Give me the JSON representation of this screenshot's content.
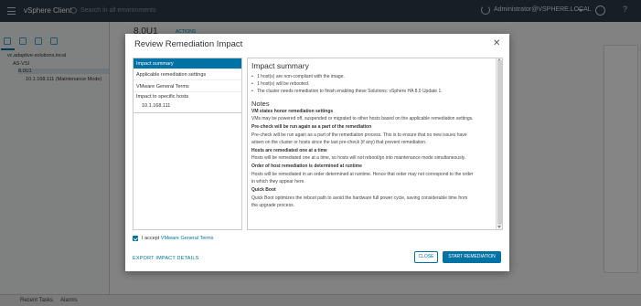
{
  "topbar": {
    "app_title": "vSphere Client",
    "search_placeholder": "Search in all environments",
    "user": "Administrator@VSPHERE.LOCAL",
    "help_icon": "?"
  },
  "leftnav": {
    "tree": [
      {
        "label": "vc.adaptive-solutions.local"
      },
      {
        "label": "AS-VSI"
      },
      {
        "label": "8.0U1"
      },
      {
        "label": "10.1.168.111 (Maintenance Mode)"
      }
    ]
  },
  "content": {
    "title": "8.0U1",
    "actions_label": "ACTIONS"
  },
  "bottombar": {
    "recent_tasks": "Recent Tasks",
    "alarms": "Alarms"
  },
  "modal": {
    "title": "Review Remediation Impact",
    "nav": {
      "items": [
        "Impact summary",
        "Applicable remediation settings",
        "VMware General Terms"
      ],
      "group_label": "Impact to specific hosts",
      "hosts": [
        "10.1.168.111"
      ]
    },
    "summary": {
      "heading": "Impact summary",
      "bullets": [
        "1 host(s) are non-compliant with the image.",
        "1 host(s) will be rebooted.",
        "The cluster needs remediation to finish enabling these Solutions: vSphere HA 8.0 Update 1."
      ],
      "notes_heading": "Notes",
      "notes": [
        {
          "title": "VM states honor remediation settings",
          "lines": [
            "VMs may be powered off, suspended or migrated to other hosts based on the applicable remediation settings."
          ]
        },
        {
          "title": "Pre-check will be run again as a part of the remediation",
          "lines": [
            "Pre-check will be run again as a part of the remediation process. This is to ensure that no new issues have",
            "arisen on the cluster or hosts since the last pre-check (if any) that prevent remediation."
          ]
        },
        {
          "title": "Hosts are remediated one at a time",
          "lines": [
            "Hosts will be remediated one at a time, so hosts will not reboot/go into maintenance mode simultaneously."
          ]
        },
        {
          "title": "Order of host remediation is determined at runtime",
          "lines": [
            "Hosts will be remediated in an order determined at runtime. Hence that order may not correspond to the order",
            "in which they appear here."
          ]
        },
        {
          "title": "Quick Boot",
          "lines": [
            "Quick Boot optimizes the reboot path to avoid the hardware full power cycle, saving considerable time from",
            "the upgrade process."
          ]
        }
      ]
    },
    "accept": {
      "prefix": "I accept",
      "link": "VMware General Terms",
      "checked": true
    },
    "export_label": "EXPORT IMPACT DETAILS",
    "close_label": "CLOSE",
    "start_label": "START REMEDIATION"
  },
  "colors": {
    "accent": "#0072a3",
    "header_bg": "#2d3a4a"
  }
}
